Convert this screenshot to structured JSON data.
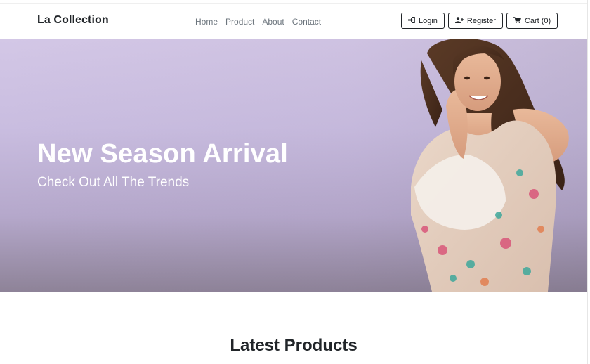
{
  "navbar": {
    "brand": "La Collection",
    "links": [
      "Home",
      "Product",
      "About",
      "Contact"
    ],
    "login_label": "Login",
    "register_label": "Register",
    "cart_label": "Cart (0)",
    "icons": {
      "login": "sign-in-icon",
      "register": "user-plus-icon",
      "cart": "shopping-cart-icon"
    }
  },
  "hero": {
    "title": "New Season Arrival",
    "subtitle": "Check Out All The Trends",
    "background_color": "#cbbfe2"
  },
  "main": {
    "section_title": "Latest Products"
  }
}
